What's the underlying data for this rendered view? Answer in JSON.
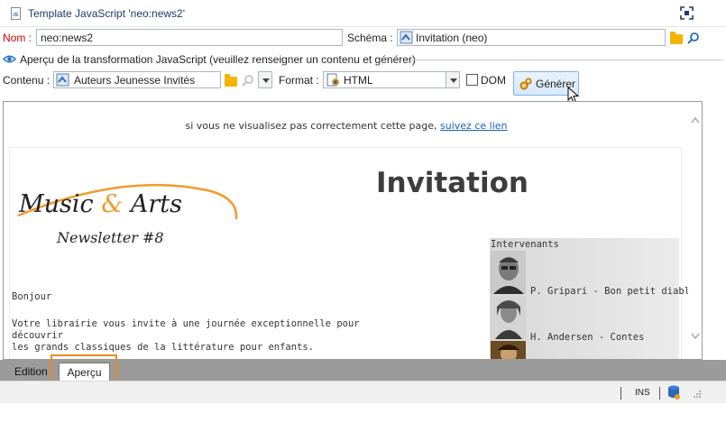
{
  "window": {
    "title": "Template JavaScript 'neo:news2'"
  },
  "form": {
    "name_label": "Nom :",
    "name_value": "neo:news2",
    "schema_label": "Schéma :",
    "schema_value": "Invitation (neo)"
  },
  "preview_section": {
    "title": "Aperçu de la transformation JavaScript (veuillez renseigner un contenu et générer)",
    "content_label": "Contenu :",
    "content_value": "Auteurs Jeunesse Invités",
    "format_label": "Format :",
    "format_value": "HTML",
    "dom_label": "DOM",
    "dom_checked": false,
    "generate_label": "Générer"
  },
  "rendered_page": {
    "top_text": "si vous ne visualisez pas correctement cette page,",
    "top_link": "suivez ce lien",
    "heading": "Invitation",
    "logo_line1": "Music",
    "logo_amp": "&",
    "logo_line2": "Arts",
    "logo_sub": "Newsletter #8",
    "greeting": "Bonjour",
    "body_line1": "Votre librairie vous invite à une journée exceptionnelle pour découvrir",
    "body_line2": "les grands classiques de la littérature pour enfants.",
    "speakers_caption": "Intervenants",
    "speakers": [
      {
        "name": "P. Gripari - Bon petit diable"
      },
      {
        "name": "H. Andersen - Contes"
      }
    ]
  },
  "tabs": {
    "edition": "Edition",
    "apercu": "Aperçu",
    "active": "apercu"
  },
  "status": {
    "mode": "INS"
  },
  "colors": {
    "required_label": "#d40000",
    "highlight": "#f08a1c",
    "link": "#1a5fb4",
    "logo_arc": "#f09a2a"
  },
  "icons": [
    "js-document-icon",
    "expand-icon",
    "schema-icon",
    "folder-icon",
    "search-icon",
    "eye-icon",
    "content-icon",
    "html-format-icon",
    "gear-icon",
    "database-icon"
  ]
}
